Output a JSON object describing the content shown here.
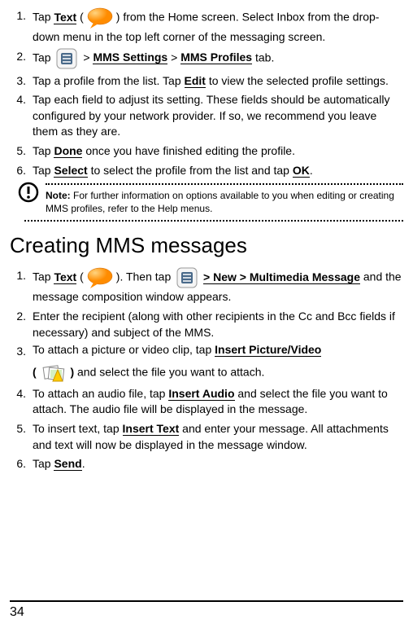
{
  "sectionA": {
    "steps": [
      {
        "num": "1.",
        "pre": "Tap ",
        "bold1": "Text",
        "mid": " (",
        "post": ") from the Home screen. Select Inbox from the drop-down menu in the top left corner of the messaging screen.",
        "icon": "bubble"
      },
      {
        "num": "2.",
        "pre": "Tap ",
        "icon": "menu",
        "mid": " > ",
        "bold1": "MMS Settings",
        "mid2": " > ",
        "bold2": "MMS Profiles",
        "post": " tab."
      },
      {
        "num": "3.",
        "pre": "Tap a profile from the list. Tap ",
        "bold1": "Edit",
        "post": " to view the selected profile settings."
      },
      {
        "num": "4.",
        "text": "Tap each field to adjust its setting. These fields should be automatically configured by your network provider. If so, we recommend you leave them as they are."
      },
      {
        "num": "5.",
        "pre": "Tap ",
        "bold1": "Done",
        "post": " once you have finished editing the profile."
      },
      {
        "num": "6.",
        "pre": "Tap ",
        "bold1": "Select",
        "mid": " to select the profile from the list and tap ",
        "bold2": "OK",
        "post": "."
      }
    ]
  },
  "note": {
    "label": "Note:",
    "text": " For further information on options available to you when editing or creating MMS profiles, refer to the Help menus."
  },
  "heading": "Creating MMS messages",
  "sectionB": {
    "steps": [
      {
        "num": "1.",
        "pre": "Tap ",
        "bold1": "Text",
        "mid": " (",
        "icon1": "bubble",
        "mid2": "). Then tap ",
        "icon2": "menu",
        "mid3": " ",
        "bold2": "> New > Multimedia Message",
        "post": " and the message composition window appears."
      },
      {
        "num": "2.",
        "text": "Enter the recipient (along with other recipients in the Cc and Bcc fields if necessary) and subject of the MMS."
      },
      {
        "num": "3.",
        "pre": "To attach a picture or video clip, tap ",
        "bold1": "Insert Picture/Video",
        "mid2b": "( ",
        "icon": "attach",
        "mid3": " )",
        "post": " and select the file you want to attach."
      },
      {
        "num": "4.",
        "pre": "To attach an audio file, tap ",
        "bold1": "Insert Audio",
        "post": " and select the file you want to attach. The audio file will be displayed in the message."
      },
      {
        "num": "5.",
        "pre": "To insert text, tap ",
        "bold1": "Insert Text",
        "post": " and enter your message. All attachments and text will now be displayed in the message window."
      },
      {
        "num": "6.",
        "pre": "Tap ",
        "bold1": "Send",
        "post": "."
      }
    ]
  },
  "pageNumber": "34"
}
